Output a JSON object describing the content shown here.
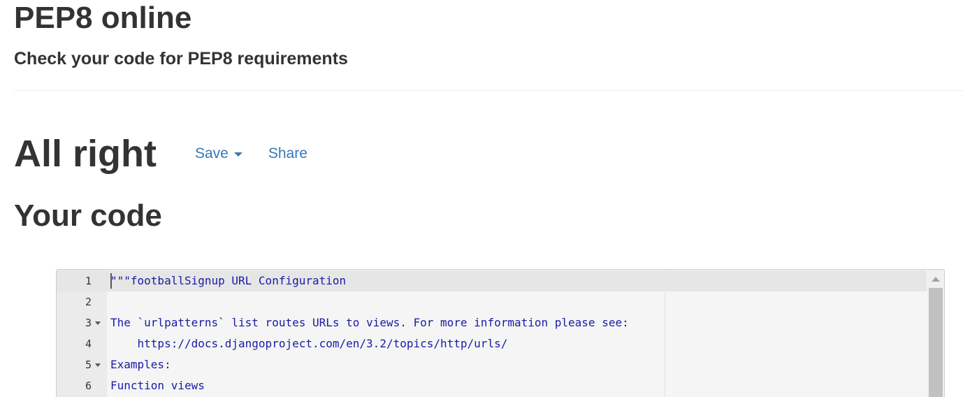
{
  "header": {
    "title": "PEP8 online",
    "subtitle": "Check your code for PEP8 requirements"
  },
  "result": {
    "title": "All right",
    "save_label": "Save",
    "share_label": "Share"
  },
  "code_section": {
    "heading": "Your code"
  },
  "editor": {
    "lines": [
      {
        "num": "1",
        "text": "\"\"\"footballSignup URL Configuration"
      },
      {
        "num": "2",
        "text": ""
      },
      {
        "num": "3",
        "text": "The `urlpatterns` list routes URLs to views. For more information please see:"
      },
      {
        "num": "4",
        "text": "    https://docs.djangoproject.com/en/3.2/topics/http/urls/"
      },
      {
        "num": "5",
        "text": "Examples:"
      },
      {
        "num": "6",
        "text": "Function views"
      }
    ]
  },
  "colors": {
    "link": "#337ab7",
    "code_string": "#1a1aa6",
    "heading": "#333333"
  }
}
